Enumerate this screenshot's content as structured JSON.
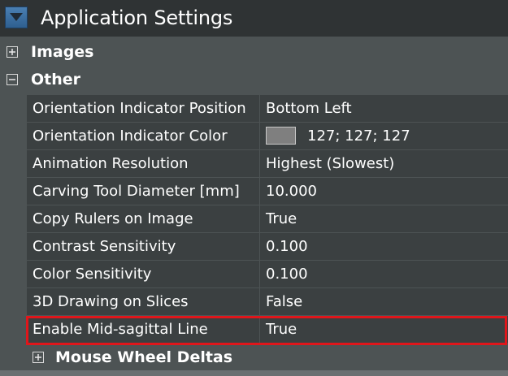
{
  "window": {
    "title": "Application Settings"
  },
  "categories": {
    "images": {
      "label": "Images",
      "expanded": false
    },
    "other": {
      "label": "Other",
      "expanded": true
    },
    "mouse_wheel_deltas": {
      "label": "Mouse Wheel Deltas",
      "expanded": false
    }
  },
  "properties": [
    {
      "name": "Orientation Indicator Position",
      "value": "Bottom Left"
    },
    {
      "name": "Orientation Indicator Color",
      "value": "127; 127; 127",
      "swatch_color": "#7f7f7f"
    },
    {
      "name": "Animation Resolution",
      "value": "Highest (Slowest)"
    },
    {
      "name": "Carving Tool Diameter [mm]",
      "value": "10.000"
    },
    {
      "name": "Copy Rulers on Image",
      "value": "True"
    },
    {
      "name": "Contrast Sensitivity",
      "value": "0.100"
    },
    {
      "name": "Color Sensitivity",
      "value": "0.100"
    },
    {
      "name": "3D Drawing on Slices",
      "value": "False"
    },
    {
      "name": "Enable Mid-sagittal Line",
      "value": "True",
      "highlighted": true
    }
  ],
  "colors": {
    "panel_bg": "#4d5354",
    "header_bg": "#2f3334",
    "cell_bg": "#3b4041",
    "highlight_border": "#e0161b"
  }
}
